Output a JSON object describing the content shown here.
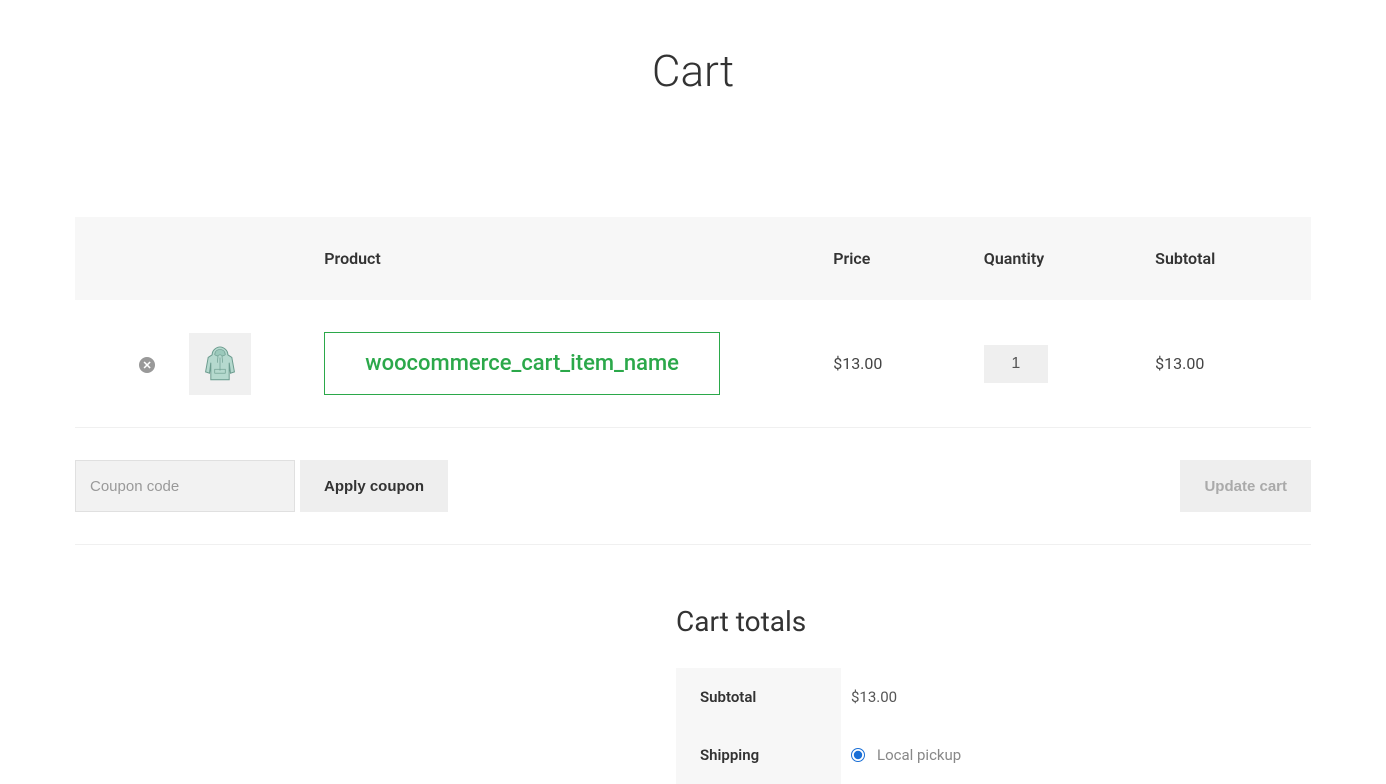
{
  "page_title": "Cart",
  "table": {
    "headers": {
      "product": "Product",
      "price": "Price",
      "quantity": "Quantity",
      "subtotal": "Subtotal"
    },
    "item": {
      "name": "woocommerce_cart_item_name",
      "price": "$13.00",
      "quantity": "1",
      "subtotal": "$13.00"
    }
  },
  "actions": {
    "coupon_placeholder": "Coupon code",
    "apply_label": "Apply coupon",
    "update_label": "Update cart"
  },
  "totals": {
    "heading": "Cart totals",
    "subtotal_label": "Subtotal",
    "subtotal_value": "$13.00",
    "shipping_label": "Shipping",
    "shipping_option": "Local pickup"
  }
}
